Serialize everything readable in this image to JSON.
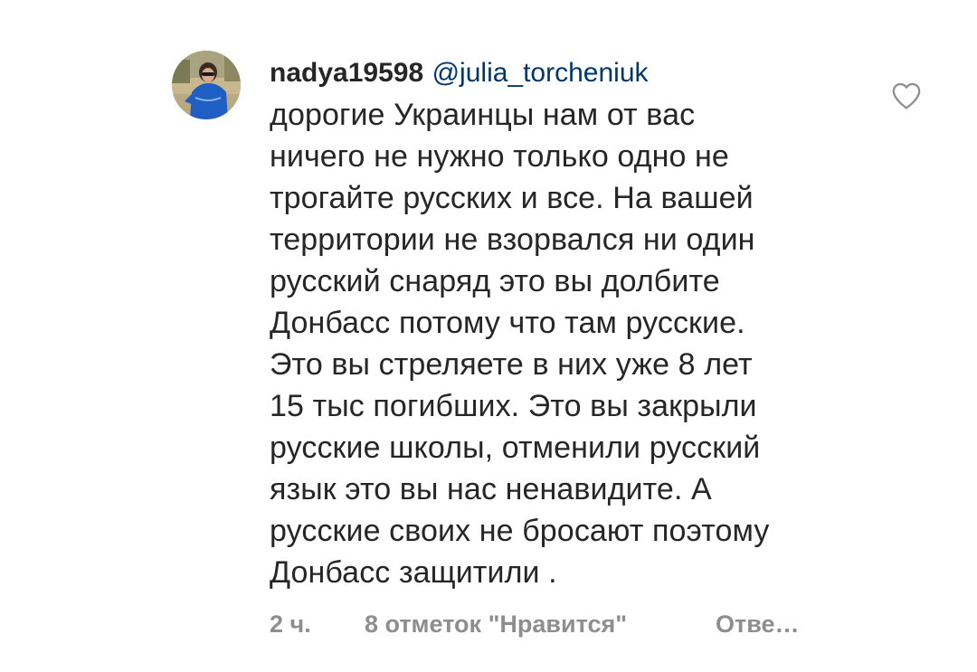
{
  "comment": {
    "username": "nadya19598",
    "mention": "@julia_torcheniuk",
    "text_first": "дорогие Украинцы нам от вас",
    "text_rest": "ничего не нужно только одно не\nтрогайте русских и все. На вашей\nтерритории не взорвался ни один\nрусский снаряд это вы долбите\nДонбасс потому что там русские.\nЭто вы стреляете в них уже 8 лет\n15 тыс погибших. Это вы закрыли\nрусские школы, отменили русский\nязык это вы нас ненавидите. А\nрусские своих не бросают поэтому\nДонбасс защитили .",
    "time": "2 ч.",
    "likes": "8 отметок \"Нравится\"",
    "reply": "Отве…"
  },
  "icons": {
    "like": "heart-outline-icon",
    "avatar": "user-avatar"
  },
  "colors": {
    "text": "#262626",
    "meta": "#8e8e8e",
    "mention": "#00376b"
  }
}
